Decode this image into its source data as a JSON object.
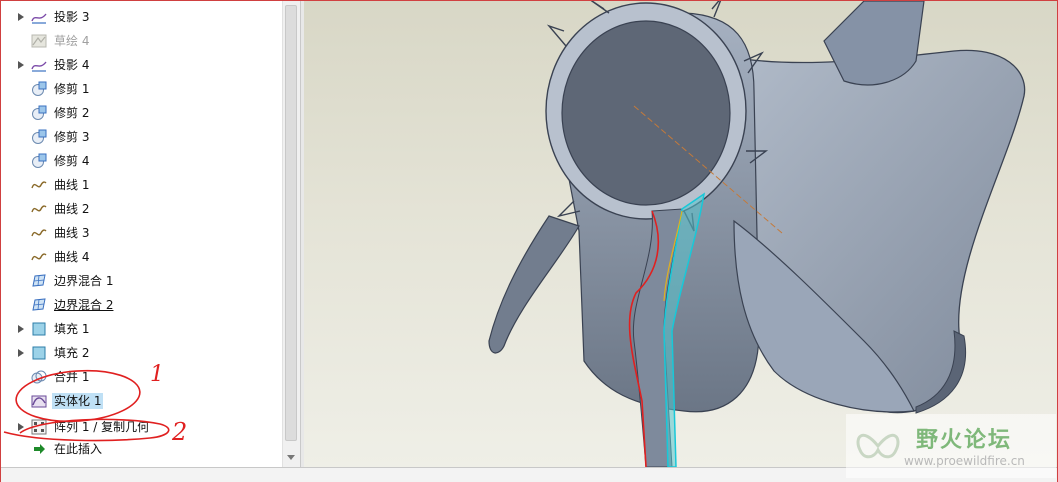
{
  "tree": {
    "items": [
      {
        "label": "投影 3",
        "icon": "projection-icon",
        "expandable": true,
        "state": "normal"
      },
      {
        "label": "草绘 4",
        "icon": "sketch-icon",
        "expandable": false,
        "state": "disabled"
      },
      {
        "label": "投影 4",
        "icon": "projection-icon",
        "expandable": true,
        "state": "normal"
      },
      {
        "label": "修剪 1",
        "icon": "trim-icon",
        "expandable": false,
        "state": "normal"
      },
      {
        "label": "修剪 2",
        "icon": "trim-icon",
        "expandable": false,
        "state": "normal"
      },
      {
        "label": "修剪 3",
        "icon": "trim-icon",
        "expandable": false,
        "state": "normal"
      },
      {
        "label": "修剪 4",
        "icon": "trim-icon",
        "expandable": false,
        "state": "normal"
      },
      {
        "label": "曲线 1",
        "icon": "curve-icon",
        "expandable": false,
        "state": "normal"
      },
      {
        "label": "曲线 2",
        "icon": "curve-icon",
        "expandable": false,
        "state": "normal"
      },
      {
        "label": "曲线 3",
        "icon": "curve-icon",
        "expandable": false,
        "state": "normal"
      },
      {
        "label": "曲线 4",
        "icon": "curve-icon",
        "expandable": false,
        "state": "normal"
      },
      {
        "label": "边界混合 1",
        "icon": "boundary-blend-icon",
        "expandable": false,
        "state": "normal"
      },
      {
        "label": "边界混合 2",
        "icon": "boundary-blend-icon",
        "expandable": false,
        "state": "underline"
      },
      {
        "label": "填充 1",
        "icon": "fill-icon",
        "expandable": true,
        "state": "normal"
      },
      {
        "label": "填充 2",
        "icon": "fill-icon",
        "expandable": true,
        "state": "normal"
      },
      {
        "label": "合并 1",
        "icon": "merge-icon",
        "expandable": false,
        "state": "normal"
      },
      {
        "label": "实体化 1",
        "icon": "solidify-icon",
        "expandable": false,
        "state": "selected"
      },
      {
        "label": "阵列 1 / 复制几何",
        "icon": "pattern-icon",
        "expandable": true,
        "state": "normal"
      },
      {
        "label": "在此插入",
        "icon": "insert-here-arrow-icon",
        "expandable": false,
        "state": "normal"
      }
    ]
  },
  "annotations": {
    "mark_1": "1",
    "mark_2": "2"
  },
  "watermark": {
    "title": "野火论坛",
    "url": "www.proewildfire.cn"
  },
  "colors": {
    "accent_selection": "#bfe0f5",
    "annotation_red": "#e02020",
    "model_gray": "#8e9aad",
    "edge_cyan": "#18c8d8"
  }
}
